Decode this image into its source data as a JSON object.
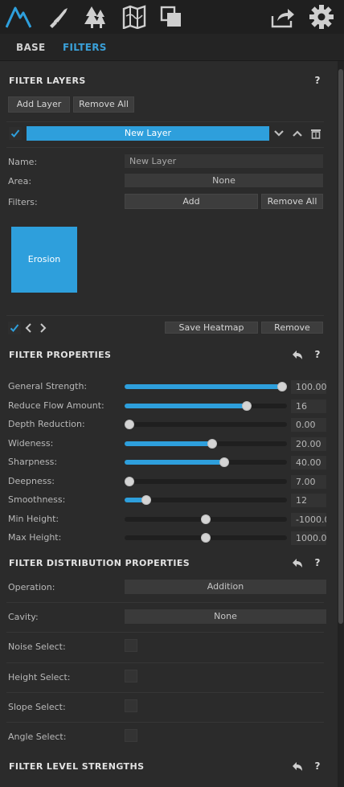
{
  "toolbar": {
    "icons": [
      "terrain-icon",
      "brush-icon",
      "trees-icon",
      "map-icon",
      "layers-icon",
      "export-icon",
      "settings-icon"
    ],
    "accent_color": "#2e9fdc"
  },
  "tabs": {
    "base": "BASE",
    "filters": "FILTERS"
  },
  "filter_layers": {
    "title": "FILTER LAYERS",
    "help": "?",
    "add_layer": "Add Layer",
    "remove_all": "Remove All",
    "layer_name_bar": "New Layer",
    "layer_enabled": true,
    "name_label": "Name:",
    "name_value": "New Layer",
    "area_label": "Area:",
    "area_value": "None",
    "filters_label": "Filters:",
    "filters_add": "Add",
    "filters_remove_all": "Remove All",
    "filter_tile": "Erosion",
    "save_heatmap": "Save Heatmap",
    "remove": "Remove"
  },
  "filter_properties": {
    "title": "FILTER PROPERTIES",
    "help": "?",
    "sliders": [
      {
        "label": "General Strength:",
        "value": "100.00",
        "fraction": 1.0,
        "filled": true
      },
      {
        "label": "Reduce Flow Amount:",
        "value": "16",
        "fraction": 0.77,
        "filled": true
      },
      {
        "label": "Depth Reduction:",
        "value": "0.00",
        "fraction": 0.0,
        "filled": true
      },
      {
        "label": "Wideness:",
        "value": "20.00",
        "fraction": 0.54,
        "filled": true
      },
      {
        "label": "Sharpness:",
        "value": "40.00",
        "fraction": 0.62,
        "filled": true
      },
      {
        "label": "Deepness:",
        "value": "7.00",
        "fraction": 0.0,
        "filled": true
      },
      {
        "label": "Smoothness:",
        "value": "12",
        "fraction": 0.11,
        "filled": true
      },
      {
        "label": "Min Height:",
        "value": "-1000.0",
        "fraction": 0.5,
        "filled": false
      },
      {
        "label": "Max Height:",
        "value": "1000.0",
        "fraction": 0.5,
        "filled": false
      }
    ]
  },
  "distribution": {
    "title": "FILTER DISTRIBUTION PROPERTIES",
    "help": "?",
    "operation_label": "Operation:",
    "operation_value": "Addition",
    "cavity_label": "Cavity:",
    "cavity_value": "None",
    "noise_label": "Noise Select:",
    "height_label": "Height Select:",
    "slope_label": "Slope Select:",
    "angle_label": "Angle Select:"
  },
  "level_strengths": {
    "title": "FILTER LEVEL STRENGTHS",
    "help": "?"
  }
}
